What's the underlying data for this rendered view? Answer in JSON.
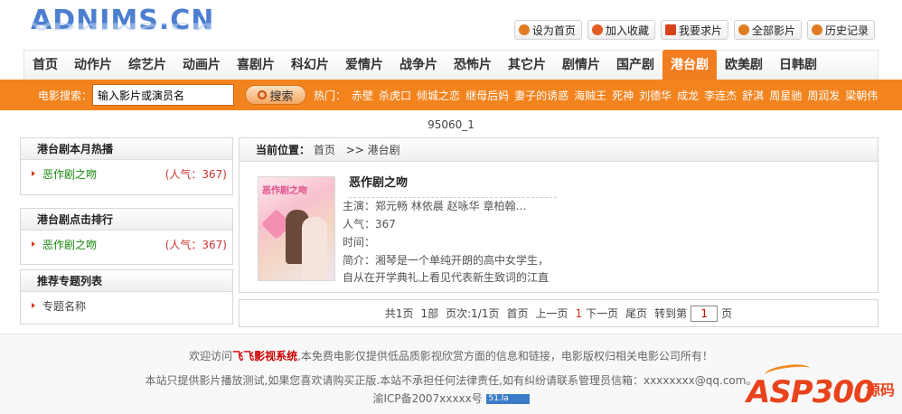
{
  "logo": {
    "text": "ADNIMS.CN"
  },
  "top_links": [
    {
      "label": "设为首页",
      "icon": "home-icon",
      "color": "#e07b22"
    },
    {
      "label": "加入收藏",
      "icon": "star-icon",
      "color": "#e05a22"
    },
    {
      "label": "我要求片",
      "icon": "request-icon",
      "color": "#d8421a"
    },
    {
      "label": "全部影片",
      "icon": "film-icon",
      "color": "#e07b22"
    },
    {
      "label": "历史记录",
      "icon": "history-icon",
      "color": "#e07b22"
    }
  ],
  "nav": {
    "items": [
      "首页",
      "动作片",
      "综艺片",
      "动画片",
      "喜剧片",
      "科幻片",
      "爱情片",
      "战争片",
      "恐怖片",
      "其它片",
      "剧情片",
      "国产剧",
      "港台剧",
      "欧美剧",
      "日韩剧"
    ],
    "active_index": 12,
    "active_color": "#f17d1e"
  },
  "search": {
    "label": "电影搜索：",
    "value": "输入影片或演员名",
    "button": "搜索",
    "hot_label": "热门：",
    "hot_links": [
      "赤壁",
      "杀虎口",
      "倾城之恋",
      "继母后妈",
      "妻子的诱惑",
      "海贼王",
      "死神",
      "刘德华",
      "成龙",
      "李连杰",
      "舒淇",
      "周星驰",
      "周润发",
      "梁朝伟"
    ]
  },
  "page_id": "95060_1",
  "sidebar": {
    "month_hot": {
      "title": "港台剧本月热播",
      "items": [
        {
          "name": "恶作剧之吻",
          "pop": "(人气：367)"
        }
      ]
    },
    "click_rank": {
      "title": "港台剧点击排行",
      "items": [
        {
          "name": "恶作剧之吻",
          "pop": "(人气：367)"
        }
      ]
    },
    "topics": {
      "title": "推荐专题列表",
      "items": [
        "专题名称"
      ]
    }
  },
  "main": {
    "location_label": "当前位置：",
    "crumb_home": "首页",
    "crumb_sep": ">>",
    "crumb_current": "港台剧",
    "poster_text": "恶作剧之吻",
    "movie": {
      "title": "恶作剧之吻",
      "actors": "主演：郑元畅 林依晨 赵咏华 章柏翰…",
      "pop": "人气：367",
      "time": "时间：",
      "intro1": "简介：湘琴是一个单纯开朗的高中女学生，",
      "intro2": "自从在开学典礼上看见代表新生致词的江直"
    }
  },
  "pager": {
    "total_pages": "共1页",
    "total_items": "1部",
    "page_info": "页次:1/1页",
    "first": "首页",
    "prev": "上一页",
    "current": "1",
    "next": "下一页",
    "last": "尾页",
    "goto": "转到第",
    "goto_value": "1",
    "page_suffix": "页"
  },
  "footer": {
    "line1_pre": "欢迎访问",
    "line1_site": "飞飞影视系统",
    "line1_post": ",本免费电影仅提供低品质影视欣赏方面的信息和链接，电影版权归相关电影公司所有！",
    "line2": "本站只提供影片播放测试,如果您喜欢请购买正版.本站不承担任何法律责任,如有纠纷请联系管理员信箱：xxxxxxxx@qq.com。",
    "icp": "渝ICP备2007xxxxx号",
    "badge": "51.la"
  },
  "watermark": {
    "text": "ASP300",
    "cn": "源码"
  }
}
